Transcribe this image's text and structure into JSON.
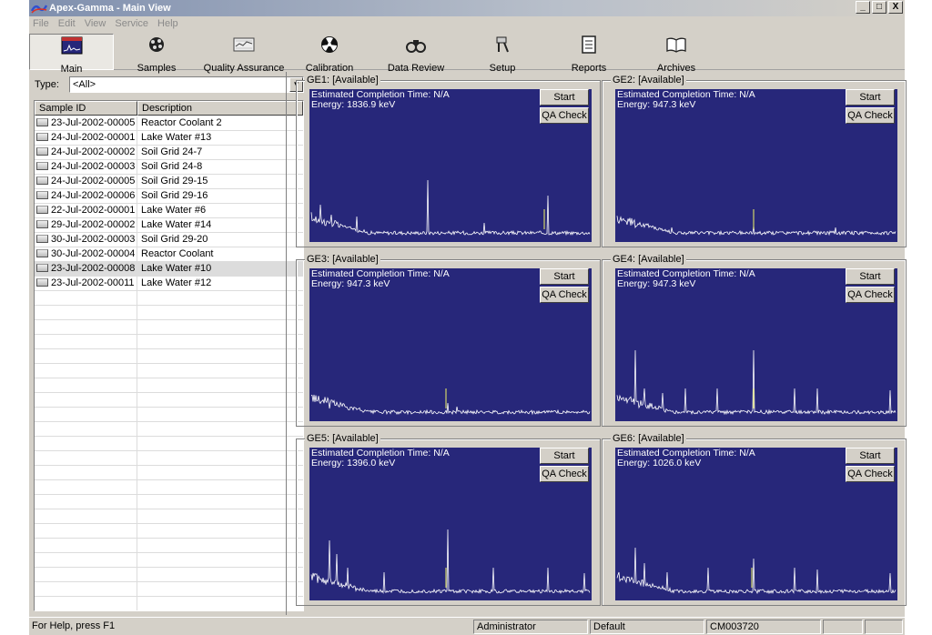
{
  "window": {
    "title": "Apex-Gamma - Main View",
    "controls": [
      "_",
      "□",
      "X"
    ]
  },
  "menu": [
    "File",
    "Edit",
    "View",
    "Service",
    "Help"
  ],
  "toolbar": [
    {
      "label": "Main",
      "icon": "spectrum-icon"
    },
    {
      "label": "Samples",
      "icon": "molecule-icon"
    },
    {
      "label": "Quality Assurance",
      "icon": "chart-icon"
    },
    {
      "label": "Calibration",
      "icon": "radiation-icon"
    },
    {
      "label": "Data Review",
      "icon": "binoculars-icon"
    },
    {
      "label": "Setup",
      "icon": "tools-icon"
    },
    {
      "label": "Reports",
      "icon": "report-icon"
    },
    {
      "label": "Archives",
      "icon": "book-icon"
    }
  ],
  "filter": {
    "label": "Type:",
    "value": "<All>"
  },
  "sample_table": {
    "headers": [
      "Sample ID",
      "Description"
    ],
    "selected_index": 10,
    "rows": [
      {
        "id": "23-Jul-2002-00005",
        "desc": "Reactor Coolant 2"
      },
      {
        "id": "24-Jul-2002-00001",
        "desc": "Lake Water #13"
      },
      {
        "id": "24-Jul-2002-00002",
        "desc": "Soil Grid 24-7"
      },
      {
        "id": "24-Jul-2002-00003",
        "desc": "Soil Grid 24-8"
      },
      {
        "id": "24-Jul-2002-00005",
        "desc": "Soil Grid 29-15"
      },
      {
        "id": "24-Jul-2002-00006",
        "desc": "Soil Grid 29-16"
      },
      {
        "id": "22-Jul-2002-00001",
        "desc": "Lake Water #6"
      },
      {
        "id": "29-Jul-2002-00002",
        "desc": "Lake Water #14"
      },
      {
        "id": "30-Jul-2002-00003",
        "desc": "Soil Grid 29-20"
      },
      {
        "id": "30-Jul-2002-00004",
        "desc": "Reactor Coolant"
      },
      {
        "id": "23-Jul-2002-00008",
        "desc": "Lake Water #10"
      },
      {
        "id": "23-Jul-2002-00011",
        "desc": "Lake Water #12"
      }
    ]
  },
  "detectors": [
    {
      "name": "GE1: [Available]",
      "completion": "Estimated Completion Time: N/A",
      "energy": "Energy:   1836.9 keV"
    },
    {
      "name": "GE2: [Available]",
      "completion": "Estimated Completion Time: N/A",
      "energy": "Energy:   947.3 keV"
    },
    {
      "name": "GE3: [Available]",
      "completion": "Estimated Completion Time: N/A",
      "energy": "Energy:   947.3 keV"
    },
    {
      "name": "GE4: [Available]",
      "completion": "Estimated Completion Time: N/A",
      "energy": "Energy:   947.3 keV"
    },
    {
      "name": "GE5: [Available]",
      "completion": "Estimated Completion Time: N/A",
      "energy": "Energy:   1396.0 keV"
    },
    {
      "name": "GE6: [Available]",
      "completion": "Estimated Completion Time: N/A",
      "energy": "Energy:   1026.0 keV"
    }
  ],
  "detector_buttons": {
    "start": "Start",
    "qa": "QA Check"
  },
  "colors": {
    "spectrum_bg": "#27277a",
    "spectrum_trace": "#ffffff",
    "marker": "#cfd36a"
  },
  "status": {
    "help": "For Help, press F1",
    "user": "Administrator",
    "profile": "Default",
    "station": "CM003720"
  }
}
